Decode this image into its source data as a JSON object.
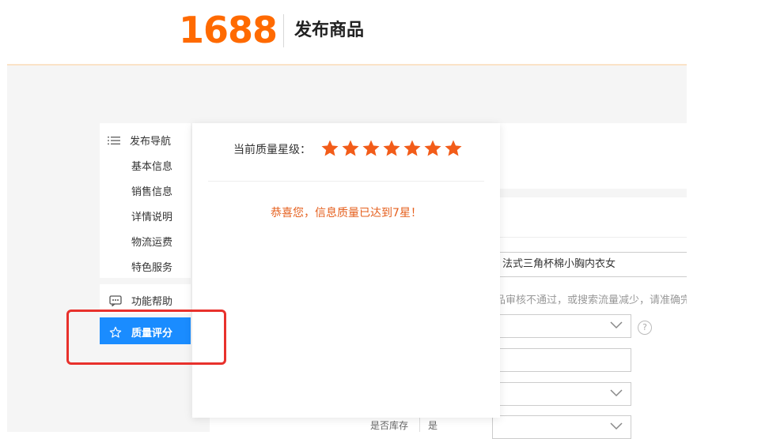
{
  "header": {
    "logo_text": "1688",
    "page_title": "发布商品"
  },
  "form": {
    "title_value": "法式三角杯棉小胸内衣女",
    "hint": "品审核不通过，或搜索流量减少，请准确完",
    "help_symbol": "?",
    "stock_label": "是否库存",
    "stock_value": "是"
  },
  "sidebar": {
    "nav_title": "发布导航",
    "items": [
      {
        "label": "基本信息"
      },
      {
        "label": "销售信息"
      },
      {
        "label": "详情说明"
      },
      {
        "label": "物流运费"
      },
      {
        "label": "特色服务"
      }
    ],
    "help_label": "功能帮助",
    "quality_label": "质量评分"
  },
  "popup": {
    "quality_level_label": "当前质量星级：",
    "stars": 7,
    "congrats_text": "恭喜您，信息质量已达到7星！"
  },
  "colors": {
    "brand_orange": "#ff6a00",
    "star_orange": "#f25c19",
    "accent_blue": "#1a8cff",
    "annotation_red": "#e8312c"
  },
  "icons": [
    "list-icon",
    "chat-icon",
    "star-outline-icon",
    "star-icon",
    "chevron-down-icon",
    "question-icon"
  ]
}
